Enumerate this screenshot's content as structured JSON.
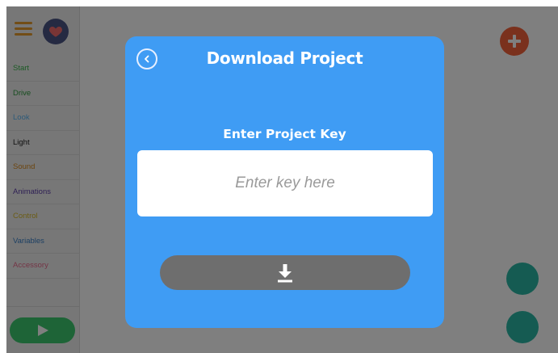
{
  "colors": {
    "modal_blue": "#3f9cf4",
    "overlay_dim": "rgba(0,0,0,0.5)",
    "add_orange": "#f5623a",
    "play_green": "#3cc96e",
    "download_gray": "#6e6e6e",
    "avatar_purple": "#4b5585",
    "heart_pink": "#f26b6b",
    "menu_orange": "#e59a2c",
    "ctrl_teal": "#2ab7a4"
  },
  "sidebar": {
    "menu_icon": "hamburger-menu-icon",
    "avatar_icon": "heart-icon",
    "categories": [
      {
        "label": "Start",
        "color": "#39b54a"
      },
      {
        "label": "Drive",
        "color": "#2e9a3e"
      },
      {
        "label": "Look",
        "color": "#5bb5f2"
      },
      {
        "label": "Light",
        "color": "#202020"
      },
      {
        "label": "Sound",
        "color": "#d98a1e"
      },
      {
        "label": "Animations",
        "color": "#5d3ea8"
      },
      {
        "label": "Control",
        "color": "#d6b92a"
      },
      {
        "label": "Variables",
        "color": "#3b80c6"
      },
      {
        "label": "Accessory",
        "color": "#e86a8c"
      }
    ],
    "play_icon": "play-icon"
  },
  "workspace": {
    "add_icon": "plus-circle-icon"
  },
  "modal": {
    "title": "Download Project",
    "back_icon": "chevron-left-icon",
    "key_label": "Enter Project Key",
    "key_input": {
      "value": "",
      "placeholder": "Enter key here"
    },
    "download_icon": "download-icon"
  }
}
